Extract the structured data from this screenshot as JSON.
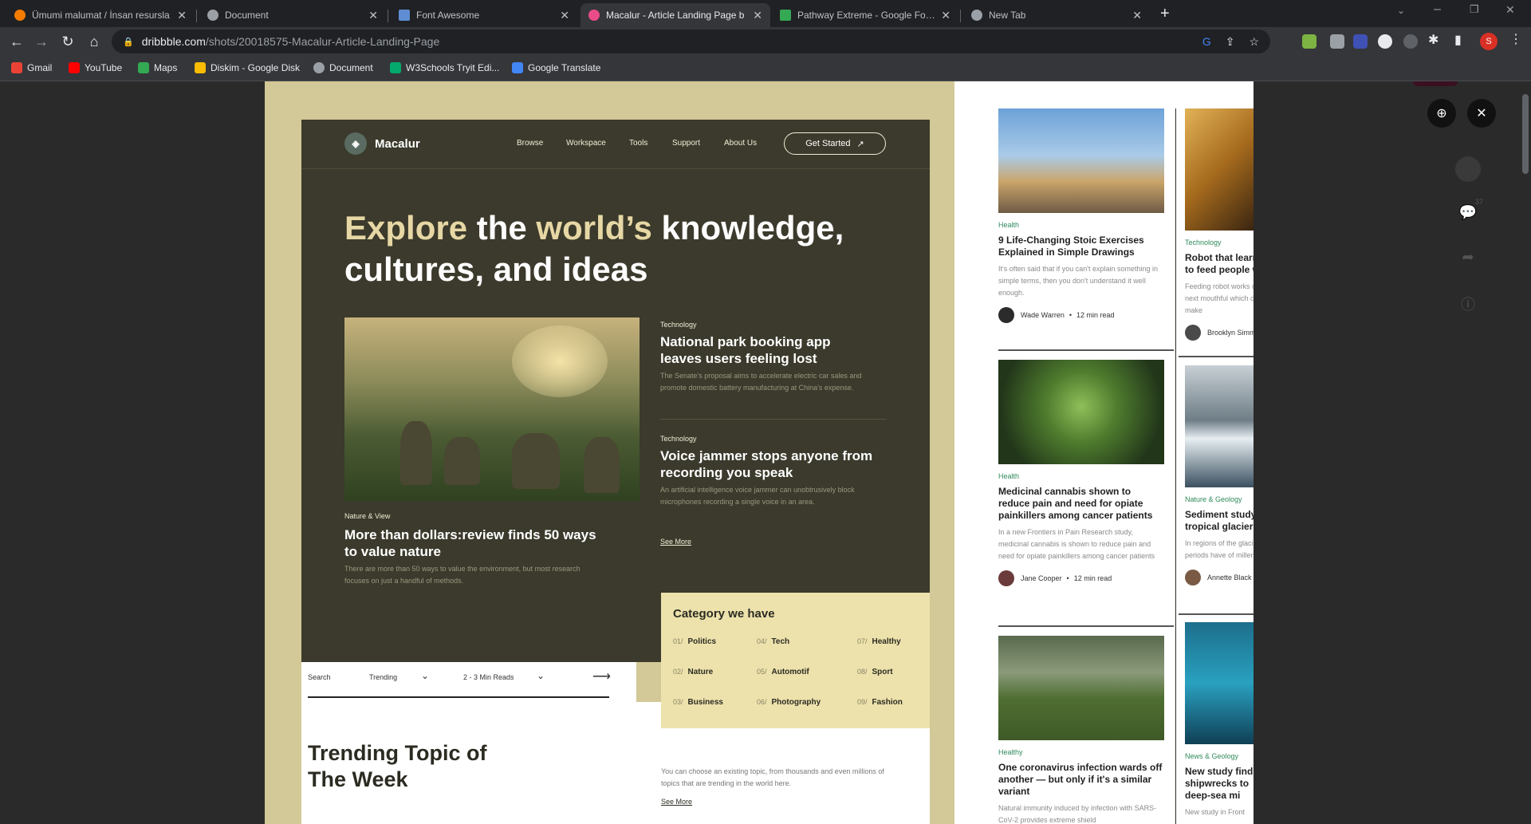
{
  "tabs": [
    {
      "title": "Ümumi malumat / İnsan resursla",
      "color": "#f57c00",
      "active": false
    },
    {
      "title": "Document",
      "color": "#9aa0a6",
      "active": false
    },
    {
      "title": "Font Awesome",
      "color": "#5f8dd3",
      "active": false
    },
    {
      "title": "Macalur - Article Landing Page b",
      "color": "#ea4c89",
      "active": true
    },
    {
      "title": "Pathway Extreme - Google Fonts",
      "color": "#34a853",
      "active": false
    },
    {
      "title": "New Tab",
      "color": "#9aa0a6",
      "active": false
    }
  ],
  "toolbar": {
    "url_host": "dribbble.com",
    "url_path": "/shots/20018575-Macalur-Article-Landing-Page",
    "profile_letter": "S"
  },
  "bookmarks": [
    {
      "label": "Gmail",
      "color": "#ea4335"
    },
    {
      "label": "YouTube",
      "color": "#ff0000"
    },
    {
      "label": "Maps",
      "color": "#34a853"
    },
    {
      "label": "Diskim - Google Disk",
      "color": "#fbbc04"
    },
    {
      "label": "Document",
      "color": "#9aa0a6"
    },
    {
      "label": "W3Schools Tryit Edi...",
      "color": "#04aa6d"
    },
    {
      "label": "Google Translate",
      "color": "#4285f4"
    }
  ],
  "site": {
    "brand": "Macalur",
    "nav": [
      "Browse",
      "Workspace",
      "Tools",
      "Support",
      "About Us"
    ],
    "cta": "Get Started",
    "cta_icon": "↗",
    "hero_1": "Explore",
    "hero_2": " the ",
    "hero_3": "world’s",
    "hero_4": " knowledge, cultures, and ideas",
    "feature": {
      "tag": "Nature & View",
      "title": "More than dollars:review finds 50 ways to value nature",
      "excerpt": "There are more than 50 ways to value the environment, but most research focuses on just a handful of methods."
    },
    "side_articles": [
      {
        "tag": "Technology",
        "title": "National park booking app leaves users feeling lost",
        "excerpt": "The Senate's proposal aims to accelerate electric car sales and promote domestic battery manufacturing at China's expense."
      },
      {
        "tag": "Technology",
        "title": "Voice jammer stops anyone from recording you speak",
        "excerpt": "An artificial intelligence voice jammer can unobtrusively block microphones recording a single voice in an area."
      }
    ],
    "see_more": "See More",
    "filter": {
      "search": "Search",
      "trending": "Trending",
      "reads": "2 - 3 Min Reads",
      "arrow": "⟶"
    },
    "category_title": "Category we have",
    "categories": [
      {
        "num": "01/",
        "label": "Politics"
      },
      {
        "num": "04/",
        "label": "Tech"
      },
      {
        "num": "07/",
        "label": "Healthy"
      },
      {
        "num": "02/",
        "label": "Nature"
      },
      {
        "num": "05/",
        "label": "Automotif"
      },
      {
        "num": "08/",
        "label": "Sport"
      },
      {
        "num": "03/",
        "label": "Business"
      },
      {
        "num": "06/",
        "label": "Photography"
      },
      {
        "num": "09/",
        "label": "Fashion"
      }
    ],
    "trending_title": "Trending Topic of The Week",
    "trending_text": "You can choose an existing topic, from thousands and even millions of topics that are trending in the world here."
  },
  "articles_col1": [
    {
      "tag": "Health",
      "title": "9 Life-Changing Stoic Exercises Explained in Simple Drawings",
      "excerpt": "It's often said that if you can't explain something in simple terms, then you don't understand it well enough.",
      "author": "Wade Warren",
      "read": "12 min read"
    },
    {
      "tag": "Health",
      "title": "Medicinal cannabis shown to reduce pain and need for opiate painkillers among cancer patients",
      "excerpt": "In a new Frontiers in Pain Research study, medicinal cannabis is shown to reduce pain and need for opiate painkillers among cancer patients",
      "author": "Jane Cooper",
      "read": "12 min read"
    },
    {
      "tag": "Healthy",
      "title": "One coronavirus infection wards off another — but only if it's a similar variant",
      "excerpt": "Natural immunity induced by infection with SARS-CoV-2 provides extreme shield",
      "author": "",
      "read": ""
    }
  ],
  "articles_col2": [
    {
      "tag": "Technology",
      "title": "Robot that learns to feed people with",
      "excerpt": "Feeding robot works out their next mouthful which could make",
      "author": "Brooklyn Simmons"
    },
    {
      "tag": "Nature & Geology",
      "title": "Sediment study of tropical glaciers",
      "excerpt": "In regions of the glacial periods have of millennia.",
      "author": "Annette Black"
    },
    {
      "tag": "News & Geology",
      "title": "New study finds shipwrecks to deep-sea mi",
      "excerpt": "New study in Front",
      "author": ""
    }
  ],
  "side_panel": {
    "comment_count": "37"
  }
}
